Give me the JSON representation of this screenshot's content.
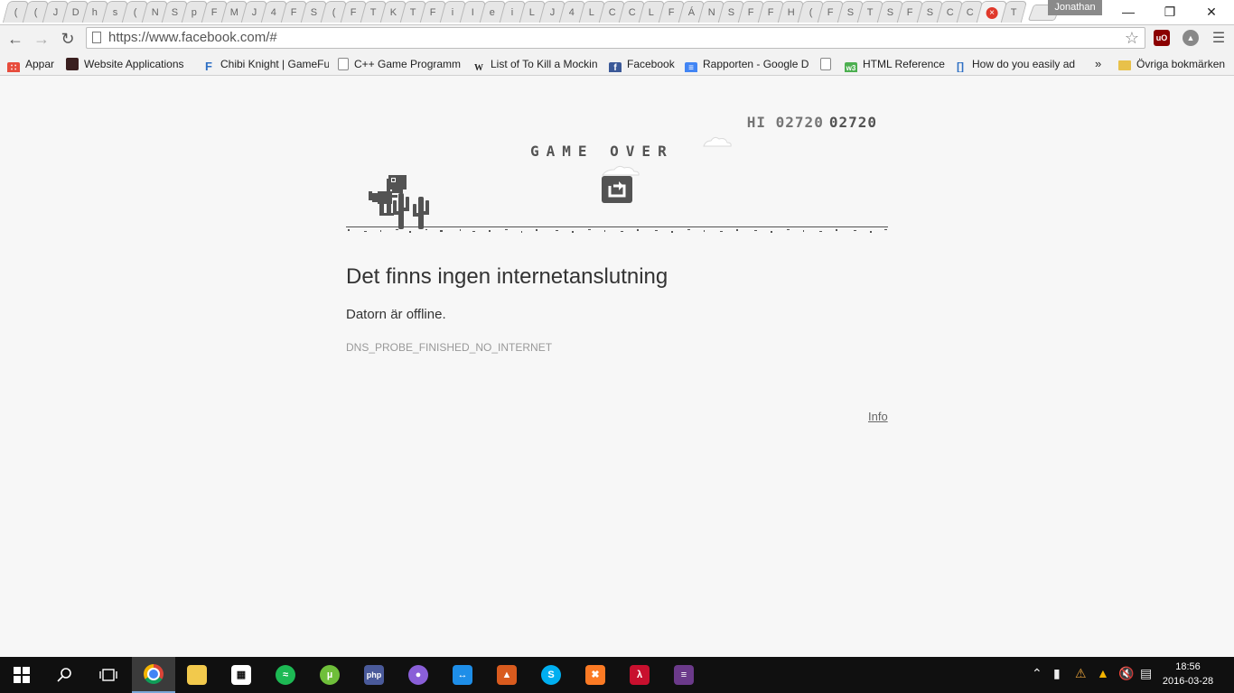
{
  "browser": {
    "tab_labels": [
      "(",
      "(",
      "J",
      "D",
      "h",
      "s",
      "(",
      "N",
      "S",
      "p",
      "F",
      "M",
      "J",
      "4",
      "F",
      "S",
      "(",
      "F",
      "T",
      "K",
      "T",
      "F",
      "i",
      "I",
      "e",
      "i",
      "L",
      "J",
      "4",
      "L",
      "C",
      "C",
      "L",
      "F",
      "Á",
      "N",
      "S",
      "F",
      "F",
      "H",
      "(",
      "F",
      "S",
      "T",
      "S",
      "F",
      "S",
      "C",
      "C"
    ],
    "active_tab_icon": "error-icon",
    "last_tab_label": "T",
    "profile_name": "Jonathan",
    "url": "https://www.facebook.com/#"
  },
  "bookmarks": [
    {
      "label": "Appar",
      "icon": "apps-grid-icon"
    },
    {
      "label": "Website Applications",
      "icon": "site-favicon"
    },
    {
      "label": "Chibi Knight | GameFu",
      "icon": "letter-f-icon"
    },
    {
      "label": "C++ Game Programm",
      "icon": "page-icon"
    },
    {
      "label": "List of To Kill a Mockin",
      "icon": "wikipedia-icon"
    },
    {
      "label": "Facebook",
      "icon": "facebook-icon"
    },
    {
      "label": "Rapporten - Google D",
      "icon": "google-docs-icon"
    },
    {
      "label": "",
      "icon": "page-icon"
    },
    {
      "label": "HTML Reference",
      "icon": "w3-icon"
    },
    {
      "label": "How do you easily ad",
      "icon": "bracket-icon"
    }
  ],
  "bookmarks_overflow": "»",
  "other_bookmarks": "Övriga bokmärken",
  "game": {
    "hi_label": "HI",
    "hi_score": "02720",
    "score": "02720",
    "game_over": "GAME OVER"
  },
  "error": {
    "heading": "Det finns ingen internetanslutning",
    "subtext": "Datorn är offline.",
    "code": "DNS_PROBE_FINISHED_NO_INTERNET",
    "info_link": "Info"
  },
  "taskbar": {
    "time": "18:56",
    "date": "2016-03-28"
  },
  "colors": {
    "page_bg": "#f7f7f7",
    "taskbar_bg": "#101010",
    "dino": "#535353"
  }
}
